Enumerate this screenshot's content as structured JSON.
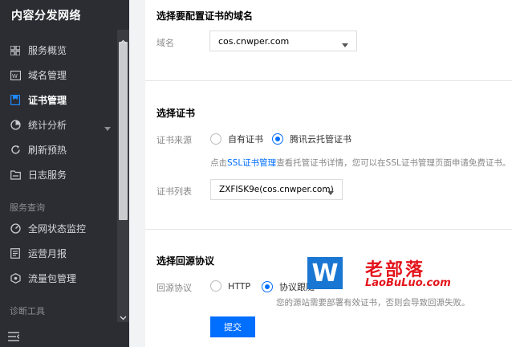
{
  "sidebar": {
    "brand": "内容分发网络",
    "items": [
      {
        "label": "服务概览",
        "icon": "grid-icon"
      },
      {
        "label": "域名管理",
        "icon": "domain-icon"
      },
      {
        "label": "证书管理",
        "icon": "certificate-icon",
        "active": true
      },
      {
        "label": "统计分析",
        "icon": "pie-chart-icon",
        "has_submenu": true
      },
      {
        "label": "刷新预热",
        "icon": "refresh-icon"
      },
      {
        "label": "日志服务",
        "icon": "folder-icon"
      },
      {
        "label": "全网状态监控",
        "icon": "gauge-icon"
      },
      {
        "label": "运营月报",
        "icon": "report-icon"
      },
      {
        "label": "流量包管理",
        "icon": "package-icon"
      }
    ],
    "section_service_query": "服务查询",
    "section_diagnose": "诊断工具"
  },
  "form": {
    "domain_section": {
      "title": "选择要配置证书的域名",
      "label": "域名",
      "value": "cos.cnwper.com"
    },
    "cert_section": {
      "title": "选择证书",
      "source_label": "证书来源",
      "source_options": [
        "自有证书",
        "腾讯云托管证书"
      ],
      "source_selected": "腾讯云托管证书",
      "hint_prefix": "点击",
      "hint_link": "SSL证书管理",
      "hint_suffix": "查看托管证书详情，您可以在SSL证书管理页面申请免费证书。",
      "list_label": "证书列表",
      "list_value": "ZXFISK9e(cos.cnwper.com)"
    },
    "origin_section": {
      "title": "选择回源协议",
      "label": "回源协议",
      "options": [
        "HTTP",
        "协议跟随"
      ],
      "selected": "协议跟随",
      "hint": "您的源站需要部署有效证书，否则会导致回源失败。"
    },
    "submit_label": "提交"
  },
  "watermark": {
    "badge": "W",
    "name": "老部落",
    "url": "LaoBuLuo.com"
  },
  "colors": {
    "sidebar_bg": "#2b2d33",
    "primary": "#006eff",
    "watermark_red": "#e4141b",
    "watermark_blue": "#1976d2"
  }
}
